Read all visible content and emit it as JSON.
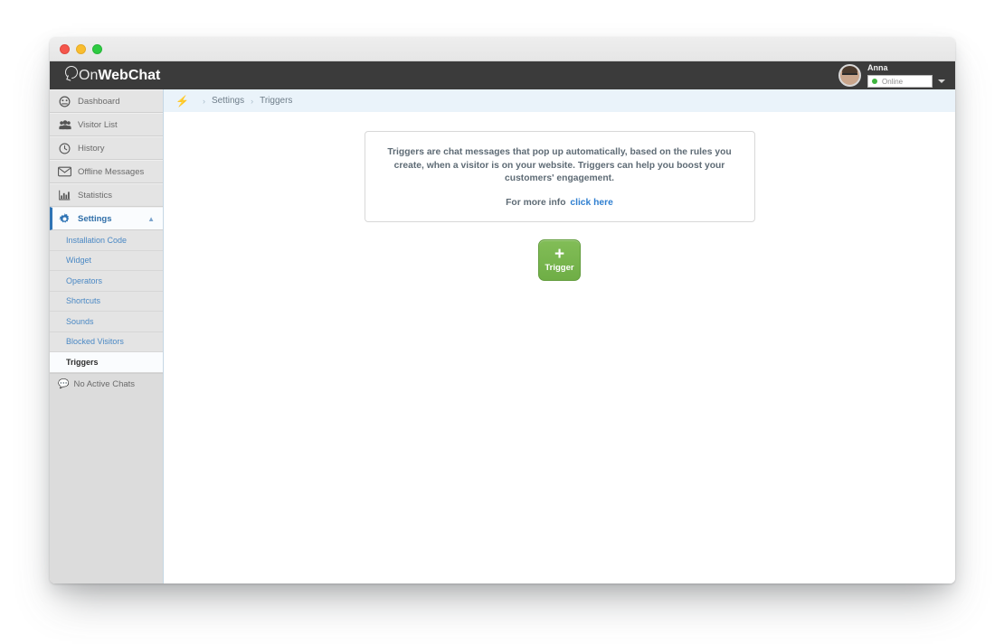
{
  "window": {
    "traffic_lights": [
      "close",
      "minimize",
      "maximize"
    ]
  },
  "appbar": {
    "logo_part1": "On",
    "logo_part2": "Web",
    "logo_part3": "Chat",
    "user_name": "Anna",
    "status_value": "Online",
    "status_color": "#3fb53f",
    "avatar_icon": "user-avatar-photo",
    "caret_icon": "chevron-down-icon"
  },
  "sidebar": {
    "items": [
      {
        "label": "Dashboard",
        "icon": "gauge-icon"
      },
      {
        "label": "Visitor List",
        "icon": "people-group-icon"
      },
      {
        "label": "History",
        "icon": "clock-icon"
      },
      {
        "label": "Offline Messages",
        "icon": "envelope-icon"
      },
      {
        "label": "Statistics",
        "icon": "bar-chart-icon"
      },
      {
        "label": "Settings",
        "icon": "gear-icon",
        "active": true,
        "caret": "chevron-up-icon"
      }
    ],
    "sub_items": [
      {
        "label": "Installation Code"
      },
      {
        "label": "Widget"
      },
      {
        "label": "Operators"
      },
      {
        "label": "Shortcuts"
      },
      {
        "label": "Sounds"
      },
      {
        "label": "Blocked Visitors"
      },
      {
        "label": "Triggers",
        "active": true
      }
    ],
    "footer": {
      "label": "No Active Chats",
      "icon": "chat-bubble-icon"
    }
  },
  "breadcrumb": {
    "icon": "lightning-bolt-icon",
    "separator": "›",
    "items": [
      "Settings",
      "Triggers"
    ]
  },
  "main": {
    "info_text": "Triggers are chat messages that pop up automatically, based on the rules you create, when a visitor is on your website. Triggers can help you boost your customers' engagement.",
    "info_more_prefix": "For more info",
    "info_more_link": "click here",
    "add_button": {
      "plus": "+",
      "label": "Trigger",
      "color": "#76b44c"
    }
  },
  "colors": {
    "appbar_bg": "#3b3b3b",
    "sidebar_bg": "#dcdcdc",
    "accent_blue": "#2f74b5",
    "link_blue": "#4a88c4",
    "breadcrumb_bg": "#eaf3fa",
    "green_button": "#76b44c"
  }
}
